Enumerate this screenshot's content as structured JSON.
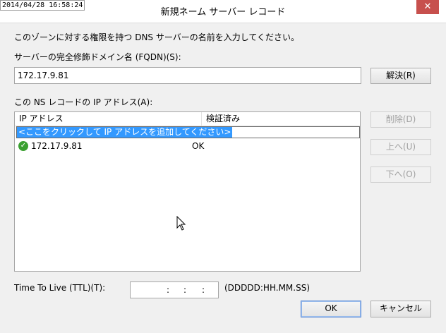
{
  "window": {
    "timestamp": "2014/04/28 16:58:24",
    "title": "新規ネーム サーバー レコード",
    "close_glyph": "✕"
  },
  "instructions": "このゾーンに対する権限を持つ DNS サーバーの名前を入力してください。",
  "fqdn": {
    "label": "サーバーの完全修飾ドメイン名 (FQDN)(S):",
    "value": "172.17.9.81",
    "resolve_button": "解決(R)"
  },
  "ip_list": {
    "label": "この NS レコードの IP アドレス(A):",
    "columns": [
      "IP アドレス",
      "検証済み"
    ],
    "edit_placeholder": "<ここをクリックして IP アドレスを追加してください>",
    "rows": [
      {
        "ip": "172.17.9.81",
        "verified": "OK",
        "status_icon": "check-circle-icon"
      }
    ]
  },
  "side_buttons": {
    "delete": "削除(D)",
    "up": "上へ(U)",
    "down": "下へ(O)"
  },
  "ttl": {
    "label": "Time To Live (TTL)(T):",
    "separators": [
      ":",
      ":",
      ":"
    ],
    "format": "(DDDDD:HH.MM.SS)"
  },
  "buttons": {
    "ok": "OK",
    "cancel": "キャンセル"
  },
  "colors": {
    "close_button": "#c7504d",
    "selection": "#3399ff",
    "ok_icon": "#3aa030"
  }
}
